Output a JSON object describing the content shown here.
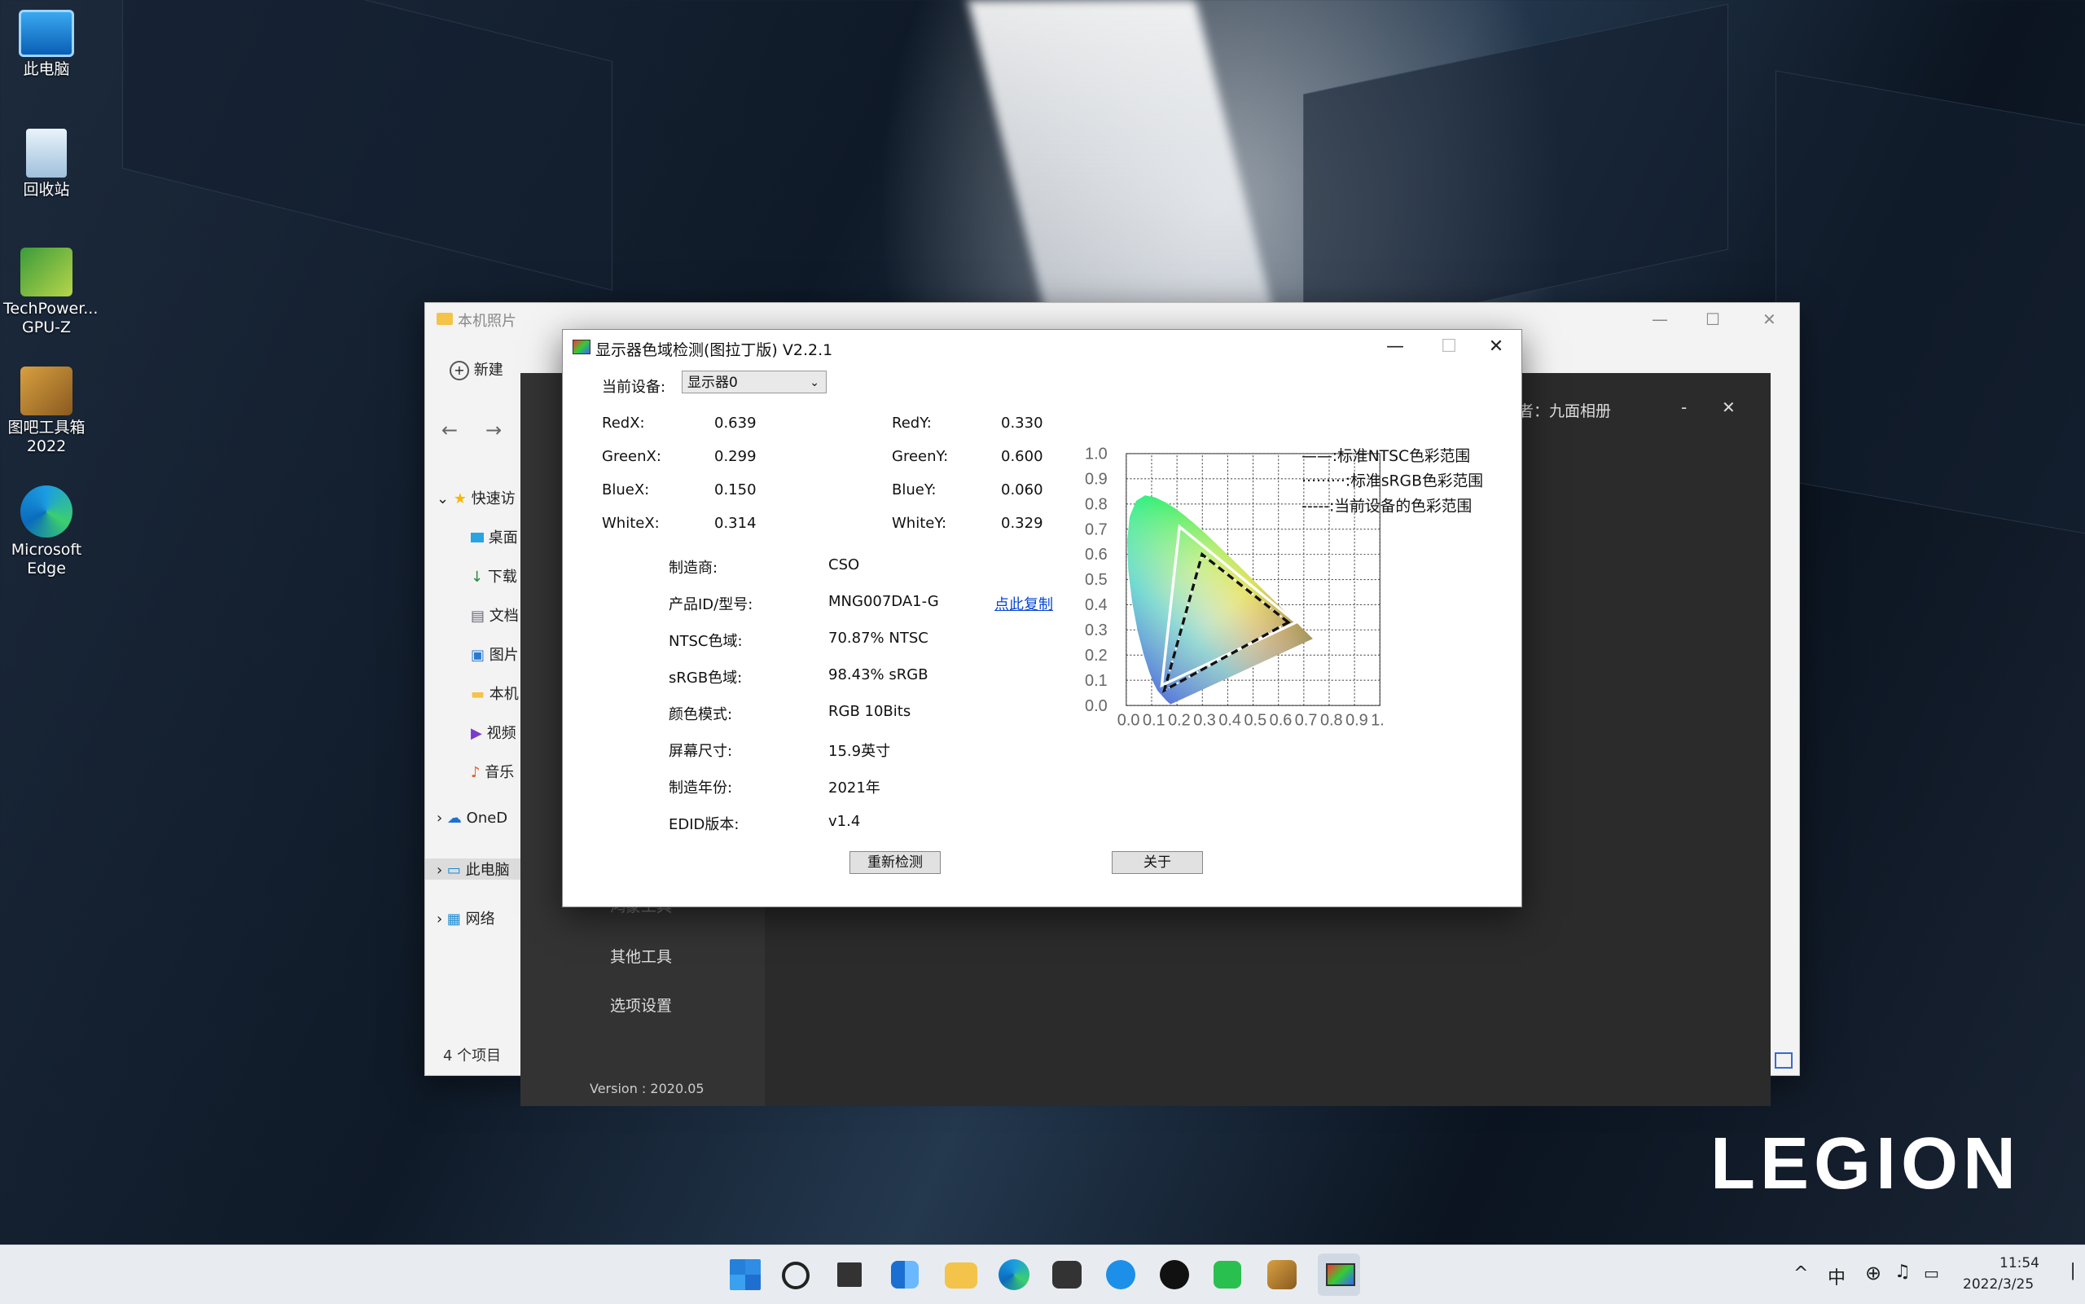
{
  "desktop": {
    "icons": [
      {
        "label": "此电脑"
      },
      {
        "label": "回收站"
      },
      {
        "label": "TechPower... GPU-Z"
      },
      {
        "label": "图吧工具箱 2022"
      },
      {
        "label": "Microsoft Edge"
      }
    ],
    "brand": "LEGION"
  },
  "explorer": {
    "title": "本机照片",
    "new_label": "新建",
    "sidebar": [
      "快速访",
      "桌面",
      "下载",
      "文档",
      "图片",
      "本机",
      "视频",
      "音乐",
      "OneD",
      "此电脑",
      "网络"
    ],
    "status": "4 个项目"
  },
  "darkapp": {
    "author": "者：九面相册",
    "menu": [
      "鸿蒙工具",
      "其他工具",
      "选项设置"
    ],
    "version": "Version : 2020.05"
  },
  "dialog": {
    "title": "显示器色域检测(图拉丁版) V2.2.1",
    "device_label": "当前设备:",
    "device_value": "显示器0",
    "coords": [
      {
        "k1": "RedX:",
        "v1": "0.639",
        "k2": "RedY:",
        "v2": "0.330"
      },
      {
        "k1": "GreenX:",
        "v1": "0.299",
        "k2": "GreenY:",
        "v2": "0.600"
      },
      {
        "k1": "BlueX:",
        "v1": "0.150",
        "k2": "BlueY:",
        "v2": "0.060"
      },
      {
        "k1": "WhiteX:",
        "v1": "0.314",
        "k2": "WhiteY:",
        "v2": "0.329"
      }
    ],
    "info": [
      {
        "k": "制造商:",
        "v": "CSO"
      },
      {
        "k": "产品ID/型号:",
        "v": "MNG007DA1-G"
      },
      {
        "k": "NTSC色域:",
        "v": "70.87% NTSC"
      },
      {
        "k": "sRGB色域:",
        "v": "98.43% sRGB"
      },
      {
        "k": "颜色模式:",
        "v": "RGB 10Bits"
      },
      {
        "k": "屏幕尺寸:",
        "v": "15.9英寸"
      },
      {
        "k": "制造年份:",
        "v": "2021年"
      },
      {
        "k": "EDID版本:",
        "v": "v1.4"
      }
    ],
    "copy_link": "点此复制",
    "recheck_button": "重新检测",
    "about_button": "关于",
    "chart": {
      "ticks": [
        "0.0",
        "0.1",
        "0.2",
        "0.3",
        "0.4",
        "0.5",
        "0.6",
        "0.7",
        "0.8",
        "0.9",
        "1."
      ],
      "yticks": [
        "0.0",
        "0.1",
        "0.2",
        "0.3",
        "0.4",
        "0.5",
        "0.6",
        "0.7",
        "0.8",
        "0.9",
        "1.0"
      ],
      "legend": [
        "——:标准NTSC色彩范围",
        "·········:标准sRGB色彩范围",
        "-----:当前设备的色彩范围"
      ],
      "srgb": [
        [
          0.64,
          0.33
        ],
        [
          0.3,
          0.6
        ],
        [
          0.15,
          0.06
        ]
      ],
      "ntsc": [
        [
          0.67,
          0.33
        ],
        [
          0.21,
          0.71
        ],
        [
          0.14,
          0.08
        ]
      ],
      "device": [
        [
          0.639,
          0.33
        ],
        [
          0.299,
          0.6
        ],
        [
          0.15,
          0.06
        ]
      ]
    }
  },
  "taskbar": {
    "lang": "中",
    "time": "11:54",
    "date": "2022/3/25"
  }
}
